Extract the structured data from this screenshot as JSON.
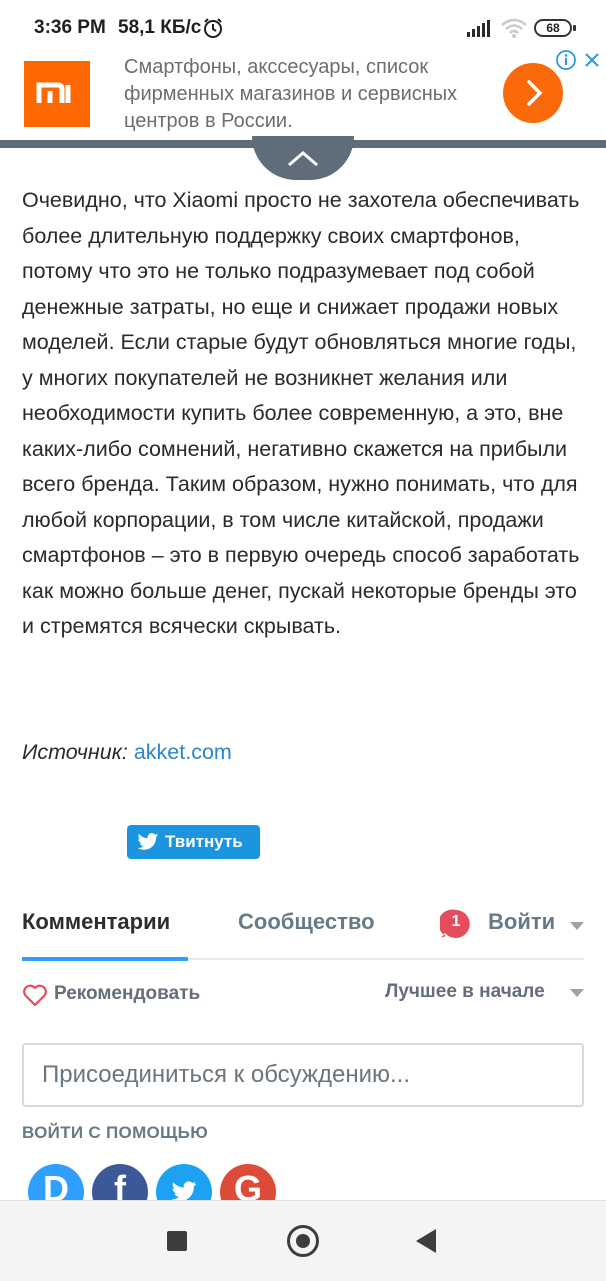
{
  "status_bar": {
    "time": "3:36 PM",
    "speed": "58,1 КБ/с",
    "battery": "68",
    "icons": [
      "alarm-icon",
      "signal-icon",
      "wifi-icon",
      "battery-icon"
    ]
  },
  "ad": {
    "logo_text": "mi",
    "text": "Смартфоны, акссесуары, список фирменных магазинов и сервисных центров в России.",
    "icons": [
      "chevron-right-icon",
      "info-icon",
      "close-icon"
    ],
    "brand_color": "#ff6700"
  },
  "article": {
    "text": "Очевидно, что Xiaomi просто не захотела обеспечивать более длительную поддержку своих смартфонов, потому что это не только подразумевает под собой денежные затраты, но еще и снижает продажи новых моделей. Если старые будут обновляться многие годы, у многих покупателей не возникнет желания или необходимости купить более современную, а это, вне каких-либо сомнений, негативно скажется на прибыли всего бренда. Таким образом, нужно понимать, что для любой корпорации, в том числе китайской, продажи смартфонов – это в первую очередь способ заработать как можно больше денег, пускай некоторые бренды это и стремятся всячески скрывать.",
    "source_label": "Источник:",
    "source_link": "akket.com",
    "link_color": "#2c84cc"
  },
  "tweet_button": {
    "label": "Твитнуть",
    "color": "#1b95e0"
  },
  "comments": {
    "tabs": [
      "Комментарии",
      "Сообщество"
    ],
    "notification_count": "1",
    "login_label": "Войти",
    "recommend_label": "Рекомендовать",
    "sort_label": "Лучшее в начале",
    "input_placeholder": "Присоединиться к обсуждению...",
    "login_with_label": "ВОЙТИ С ПОМОЩЬЮ",
    "social_logins": [
      {
        "name": "disqus",
        "letter": "D",
        "color": "#2e9fff"
      },
      {
        "name": "facebook",
        "letter": "f",
        "color": "#3b5998"
      },
      {
        "name": "twitter",
        "letter": "",
        "color": "#1da1f2"
      },
      {
        "name": "google",
        "letter": "G",
        "color": "#dd4b39"
      }
    ],
    "accent_color": "#2e9fff"
  },
  "nav_bar": {
    "icons": [
      "recents-square-icon",
      "home-circle-icon",
      "back-triangle-icon"
    ]
  }
}
